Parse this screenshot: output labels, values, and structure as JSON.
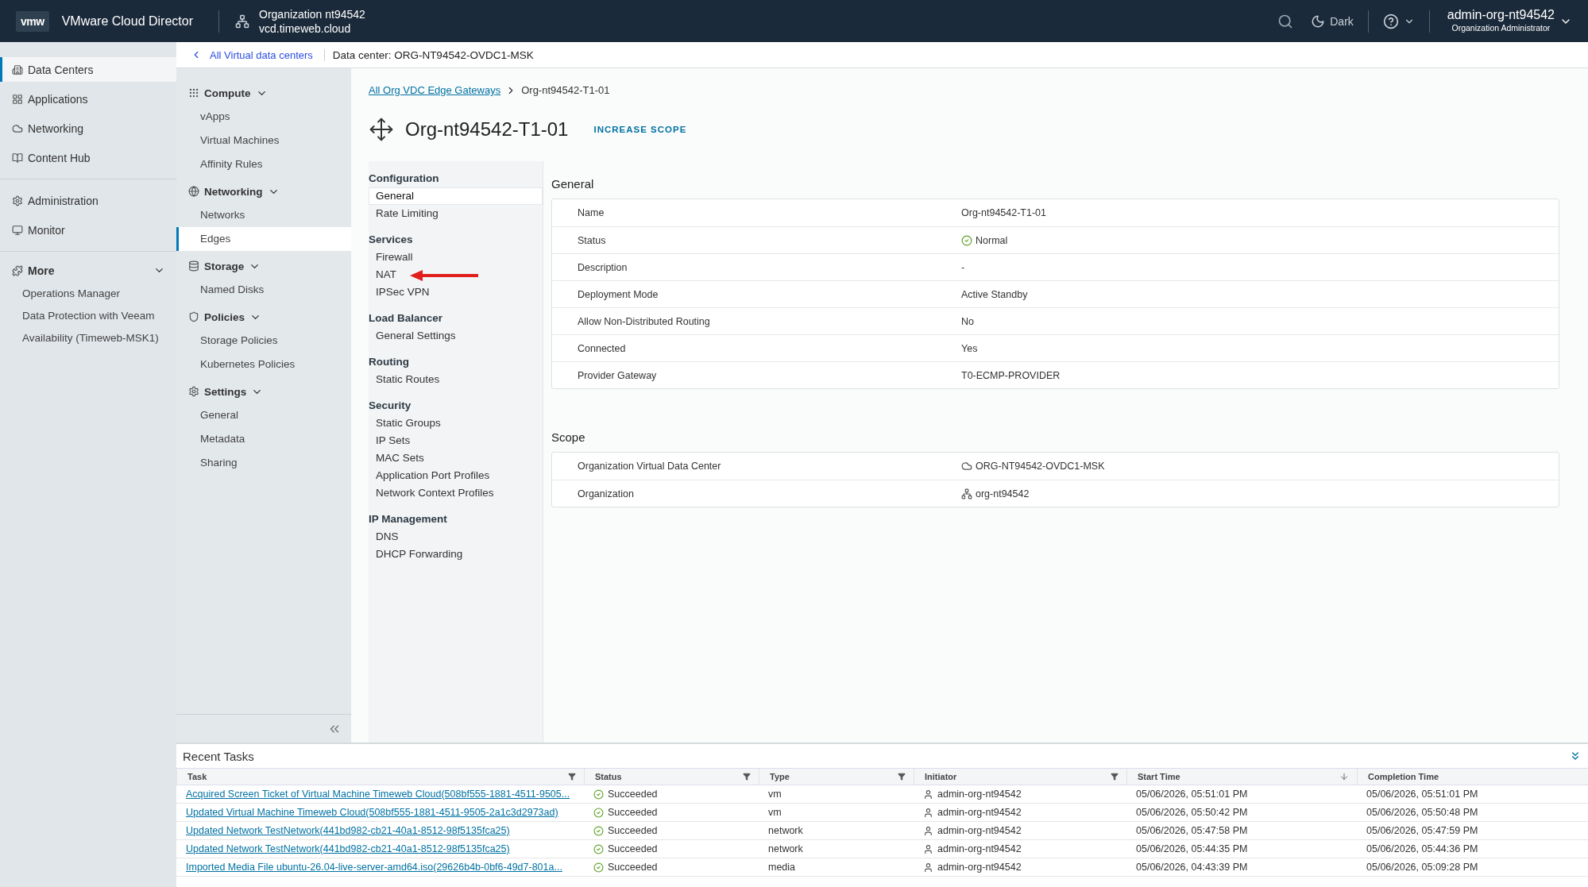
{
  "header": {
    "logo": "vmw",
    "product": "VMware Cloud Director",
    "org_name": "Organization nt94542",
    "org_url": "vcd.timeweb.cloud",
    "theme_toggle": "Dark",
    "user": "admin-org-nt94542",
    "role": "Organization Administrator"
  },
  "sidebar": {
    "items": [
      {
        "label": "Data Centers",
        "selected": true
      },
      {
        "label": "Applications",
        "selected": false
      },
      {
        "label": "Networking",
        "selected": false
      },
      {
        "label": "Content Hub",
        "selected": false
      },
      {
        "label": "Administration",
        "selected": false
      },
      {
        "label": "Monitor",
        "selected": false
      }
    ],
    "more": {
      "label": "More",
      "expanded": true,
      "children": [
        {
          "label": "Operations Manager",
          "selected": false
        },
        {
          "label": "Data Protection with Veeam",
          "selected": false
        },
        {
          "label": "Availability (Timeweb-MSK1)",
          "selected": false
        }
      ]
    }
  },
  "breadcrumb_bar": {
    "back_link": "All Virtual data centers",
    "data_center": "Data center: ORG-NT94542-OVDC1-MSK"
  },
  "vdc_nav": {
    "sections": [
      {
        "title": "Compute",
        "expanded": true,
        "items": [
          {
            "label": "vApps",
            "selected": false
          },
          {
            "label": "Virtual Machines",
            "selected": false
          },
          {
            "label": "Affinity Rules",
            "selected": false
          }
        ]
      },
      {
        "title": "Networking",
        "expanded": true,
        "items": [
          {
            "label": "Networks",
            "selected": false
          },
          {
            "label": "Edges",
            "selected": true
          }
        ]
      },
      {
        "title": "Storage",
        "expanded": true,
        "items": [
          {
            "label": "Named Disks",
            "selected": false
          }
        ]
      },
      {
        "title": "Policies",
        "expanded": true,
        "items": [
          {
            "label": "Storage Policies",
            "selected": false
          },
          {
            "label": "Kubernetes Policies",
            "selected": false
          }
        ]
      },
      {
        "title": "Settings",
        "expanded": true,
        "items": [
          {
            "label": "General",
            "selected": false
          },
          {
            "label": "Metadata",
            "selected": false
          },
          {
            "label": "Sharing",
            "selected": false
          }
        ]
      }
    ]
  },
  "edge": {
    "breadcrumb_link": "All Org VDC Edge Gateways",
    "breadcrumb_current": "Org-nt94542-T1-01",
    "title": "Org-nt94542-T1-01",
    "action": "INCREASE SCOPE",
    "nav": [
      {
        "title": "Configuration",
        "items": [
          {
            "label": "General",
            "selected": true,
            "pointer": false
          },
          {
            "label": "Rate Limiting",
            "selected": false,
            "pointer": false
          }
        ]
      },
      {
        "title": "Services",
        "items": [
          {
            "label": "Firewall",
            "selected": false,
            "pointer": false
          },
          {
            "label": "NAT",
            "selected": false,
            "pointer": true
          },
          {
            "label": "IPSec VPN",
            "selected": false,
            "pointer": false
          }
        ]
      },
      {
        "title": "Load Balancer",
        "items": [
          {
            "label": "General Settings",
            "selected": false,
            "pointer": false
          }
        ]
      },
      {
        "title": "Routing",
        "items": [
          {
            "label": "Static Routes",
            "selected": false,
            "pointer": false
          }
        ]
      },
      {
        "title": "Security",
        "items": [
          {
            "label": "Static Groups",
            "selected": false,
            "pointer": false
          },
          {
            "label": "IP Sets",
            "selected": false,
            "pointer": false
          },
          {
            "label": "MAC Sets",
            "selected": false,
            "pointer": false
          },
          {
            "label": "Application Port Profiles",
            "selected": false,
            "pointer": false
          },
          {
            "label": "Network Context Profiles",
            "selected": false,
            "pointer": false
          }
        ]
      },
      {
        "title": "IP Management",
        "items": [
          {
            "label": "DNS",
            "selected": false,
            "pointer": false
          },
          {
            "label": "DHCP Forwarding",
            "selected": false,
            "pointer": false
          }
        ]
      }
    ],
    "panels": [
      {
        "title": "General",
        "rows": [
          {
            "label": "Name",
            "value": "Org-nt94542-T1-01",
            "kind": "text"
          },
          {
            "label": "Status",
            "value": "Normal",
            "kind": "ok"
          },
          {
            "label": "Description",
            "value": "-",
            "kind": "text"
          },
          {
            "label": "Deployment Mode",
            "value": "Active Standby",
            "kind": "text"
          },
          {
            "label": "Allow Non-Distributed Routing",
            "value": "No",
            "kind": "text"
          },
          {
            "label": "Connected",
            "value": "Yes",
            "kind": "text"
          },
          {
            "label": "Provider Gateway",
            "value": "T0-ECMP-PROVIDER",
            "kind": "text"
          }
        ]
      },
      {
        "title": "Scope",
        "rows": [
          {
            "label": "Organization Virtual Data Center",
            "value": "ORG-NT94542-OVDC1-MSK",
            "kind": "vdc"
          },
          {
            "label": "Organization",
            "value": "org-nt94542",
            "kind": "org"
          }
        ]
      }
    ]
  },
  "tasks": {
    "title": "Recent Tasks",
    "columns": [
      {
        "label": "Task",
        "filter": true,
        "sort": false
      },
      {
        "label": "Status",
        "filter": true,
        "sort": false
      },
      {
        "label": "Type",
        "filter": true,
        "sort": false
      },
      {
        "label": "Initiator",
        "filter": true,
        "sort": false
      },
      {
        "label": "Start Time",
        "filter": false,
        "sort": true
      },
      {
        "label": "Completion Time",
        "filter": false,
        "sort": false
      }
    ],
    "rows": [
      {
        "task": "Acquired Screen Ticket of Virtual Machine Timeweb Cloud(508bf555-1881-4511-9505...",
        "status": "Succeeded",
        "type": "vm",
        "initiator": "admin-org-nt94542",
        "start": "05/06/2026, 05:51:01 PM",
        "completion": "05/06/2026, 05:51:01 PM"
      },
      {
        "task": "Updated Virtual Machine Timeweb Cloud(508bf555-1881-4511-9505-2a1c3d2973ad)",
        "status": "Succeeded",
        "type": "vm",
        "initiator": "admin-org-nt94542",
        "start": "05/06/2026, 05:50:42 PM",
        "completion": "05/06/2026, 05:50:48 PM"
      },
      {
        "task": "Updated Network TestNetwork(441bd982-cb21-40a1-8512-98f5135fca25)",
        "status": "Succeeded",
        "type": "network",
        "initiator": "admin-org-nt94542",
        "start": "05/06/2026, 05:47:58 PM",
        "completion": "05/06/2026, 05:47:59 PM"
      },
      {
        "task": "Updated Network TestNetwork(441bd982-cb21-40a1-8512-98f5135fca25)",
        "status": "Succeeded",
        "type": "network",
        "initiator": "admin-org-nt94542",
        "start": "05/06/2026, 05:44:35 PM",
        "completion": "05/06/2026, 05:44:36 PM"
      },
      {
        "task": "Imported Media File ubuntu-26.04-live-server-amd64.iso(29626b4b-0bf6-49d7-801a...",
        "status": "Succeeded",
        "type": "media",
        "initiator": "admin-org-nt94542",
        "start": "05/06/2026, 04:43:39 PM",
        "completion": "05/06/2026, 05:09:28 PM"
      }
    ]
  }
}
